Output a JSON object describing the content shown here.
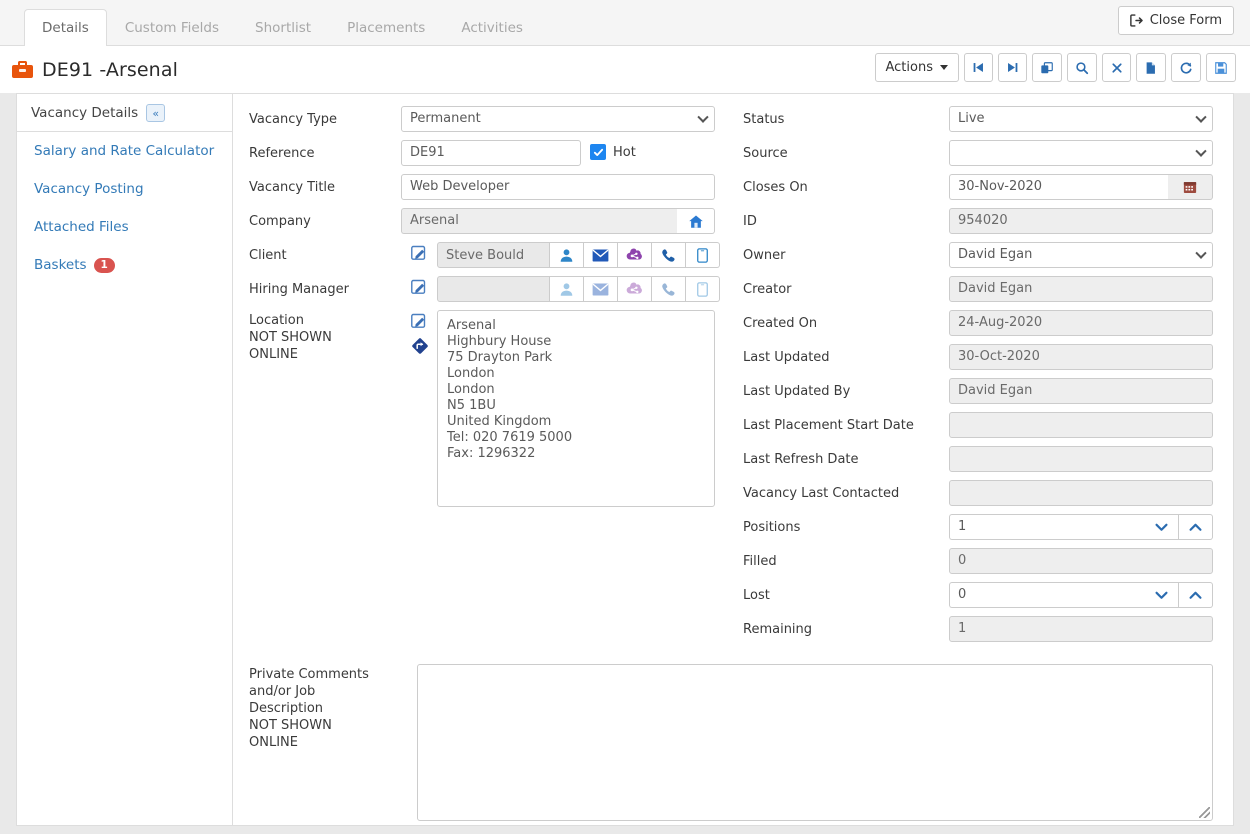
{
  "tabs": [
    {
      "label": "Details",
      "active": true
    },
    {
      "label": "Custom Fields",
      "active": false
    },
    {
      "label": "Shortlist",
      "active": false
    },
    {
      "label": "Placements",
      "active": false
    },
    {
      "label": "Activities",
      "active": false
    }
  ],
  "header": {
    "close_form_label": "Close Form",
    "title": "DE91 -Arsenal",
    "icon": "briefcase-icon"
  },
  "toolbar": {
    "actions_label": "Actions",
    "buttons": [
      {
        "name": "first-record-button",
        "icon": "skip-backward-icon"
      },
      {
        "name": "last-record-button",
        "icon": "skip-forward-icon"
      },
      {
        "name": "copy-records-button",
        "icon": "copy-icon"
      },
      {
        "name": "search-button",
        "icon": "magnifier-icon"
      },
      {
        "name": "delete-button",
        "icon": "cross-icon"
      },
      {
        "name": "duplicate-button",
        "icon": "page-copy-icon"
      },
      {
        "name": "refresh-button",
        "icon": "refresh-icon"
      },
      {
        "name": "save-button",
        "icon": "floppy-disk-icon"
      }
    ]
  },
  "sidebar": {
    "heading": "Vacancy Details",
    "collapse_icon": "double-chevron-left-icon",
    "items": [
      {
        "label": "Salary and Rate Calculator",
        "badge": null
      },
      {
        "label": "Vacancy Posting",
        "badge": null
      },
      {
        "label": "Attached Files",
        "badge": null
      },
      {
        "label": "Baskets",
        "badge": "1"
      }
    ]
  },
  "left_form": {
    "vacancy_type": {
      "label": "Vacancy Type",
      "value": "Permanent"
    },
    "reference": {
      "label": "Reference",
      "value": "DE91"
    },
    "hot": {
      "label": "Hot",
      "checked": true
    },
    "vacancy_title": {
      "label": "Vacancy Title",
      "value": "Web Developer"
    },
    "company": {
      "label": "Company",
      "value": "Arsenal"
    },
    "client": {
      "label": "Client",
      "value": "Steve Bould"
    },
    "hiring_manager": {
      "label": "Hiring Manager",
      "value": ""
    },
    "location": {
      "label_line1": "Location",
      "label_line2": "NOT SHOWN",
      "label_line3": "ONLINE",
      "value": "Arsenal\nHighbury House\n75 Drayton Park\nLondon\nLondon\nN5 1BU\nUnited Kingdom\nTel: 020 7619 5000\nFax: 1296322"
    },
    "contact_actions": [
      {
        "name": "contact-person-icon",
        "label": "person"
      },
      {
        "name": "send-email-icon",
        "label": "email"
      },
      {
        "name": "social-network-icon",
        "label": "social"
      },
      {
        "name": "call-phone-icon",
        "label": "phone"
      },
      {
        "name": "call-mobile-icon",
        "label": "mobile"
      }
    ]
  },
  "right_form": {
    "status": {
      "label": "Status",
      "value": "Live"
    },
    "source": {
      "label": "Source",
      "value": ""
    },
    "closes_on": {
      "label": "Closes On",
      "value": "30-Nov-2020"
    },
    "id": {
      "label": "ID",
      "value": "954020"
    },
    "owner": {
      "label": "Owner",
      "value": "David Egan"
    },
    "creator": {
      "label": "Creator",
      "value": "David Egan"
    },
    "created_on": {
      "label": "Created On",
      "value": "24-Aug-2020"
    },
    "last_updated": {
      "label": "Last Updated",
      "value": "30-Oct-2020"
    },
    "last_updated_by": {
      "label": "Last Updated By",
      "value": "David Egan"
    },
    "last_placement_start_date": {
      "label": "Last Placement Start Date",
      "value": ""
    },
    "last_refresh_date": {
      "label": "Last Refresh Date",
      "value": ""
    },
    "vacancy_last_contacted": {
      "label": "Vacancy Last Contacted",
      "value": ""
    },
    "positions": {
      "label": "Positions",
      "value": "1"
    },
    "filled": {
      "label": "Filled",
      "value": "0"
    },
    "lost": {
      "label": "Lost",
      "value": "0"
    },
    "remaining": {
      "label": "Remaining",
      "value": "1"
    }
  },
  "bottom": {
    "label_line1": "Private Comments",
    "label_line2": "and/or Job",
    "label_line3": "Description",
    "label_line4": "NOT SHOWN",
    "label_line5": "ONLINE",
    "value": ""
  },
  "colors": {
    "accent": "#2b6cb0",
    "link": "#337ab7",
    "badge": "#d9534f",
    "briefcase": "#e8540c",
    "checkbox": "#1e86f0",
    "calendar": "#9e4b3f"
  }
}
